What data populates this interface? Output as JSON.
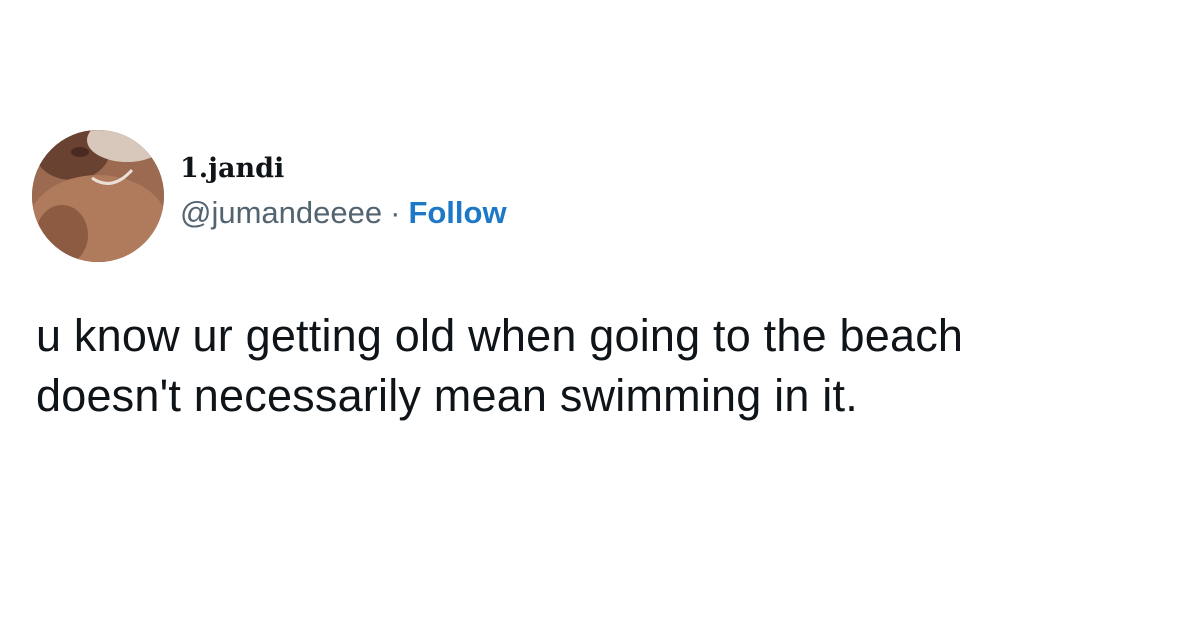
{
  "tweet": {
    "author": {
      "display_name": "1.jandi",
      "handle": "@jumandeeee",
      "separator": "·",
      "follow_label": "Follow",
      "avatar_icon": "profile-photo"
    },
    "text_lines": [
      "u know ur getting old when going to the beach",
      "doesn't necessarily mean swimming in it."
    ]
  },
  "colors": {
    "background": "#ffffff",
    "text": "#0f1419",
    "handle": "#536471",
    "follow": "#1d79c7"
  }
}
